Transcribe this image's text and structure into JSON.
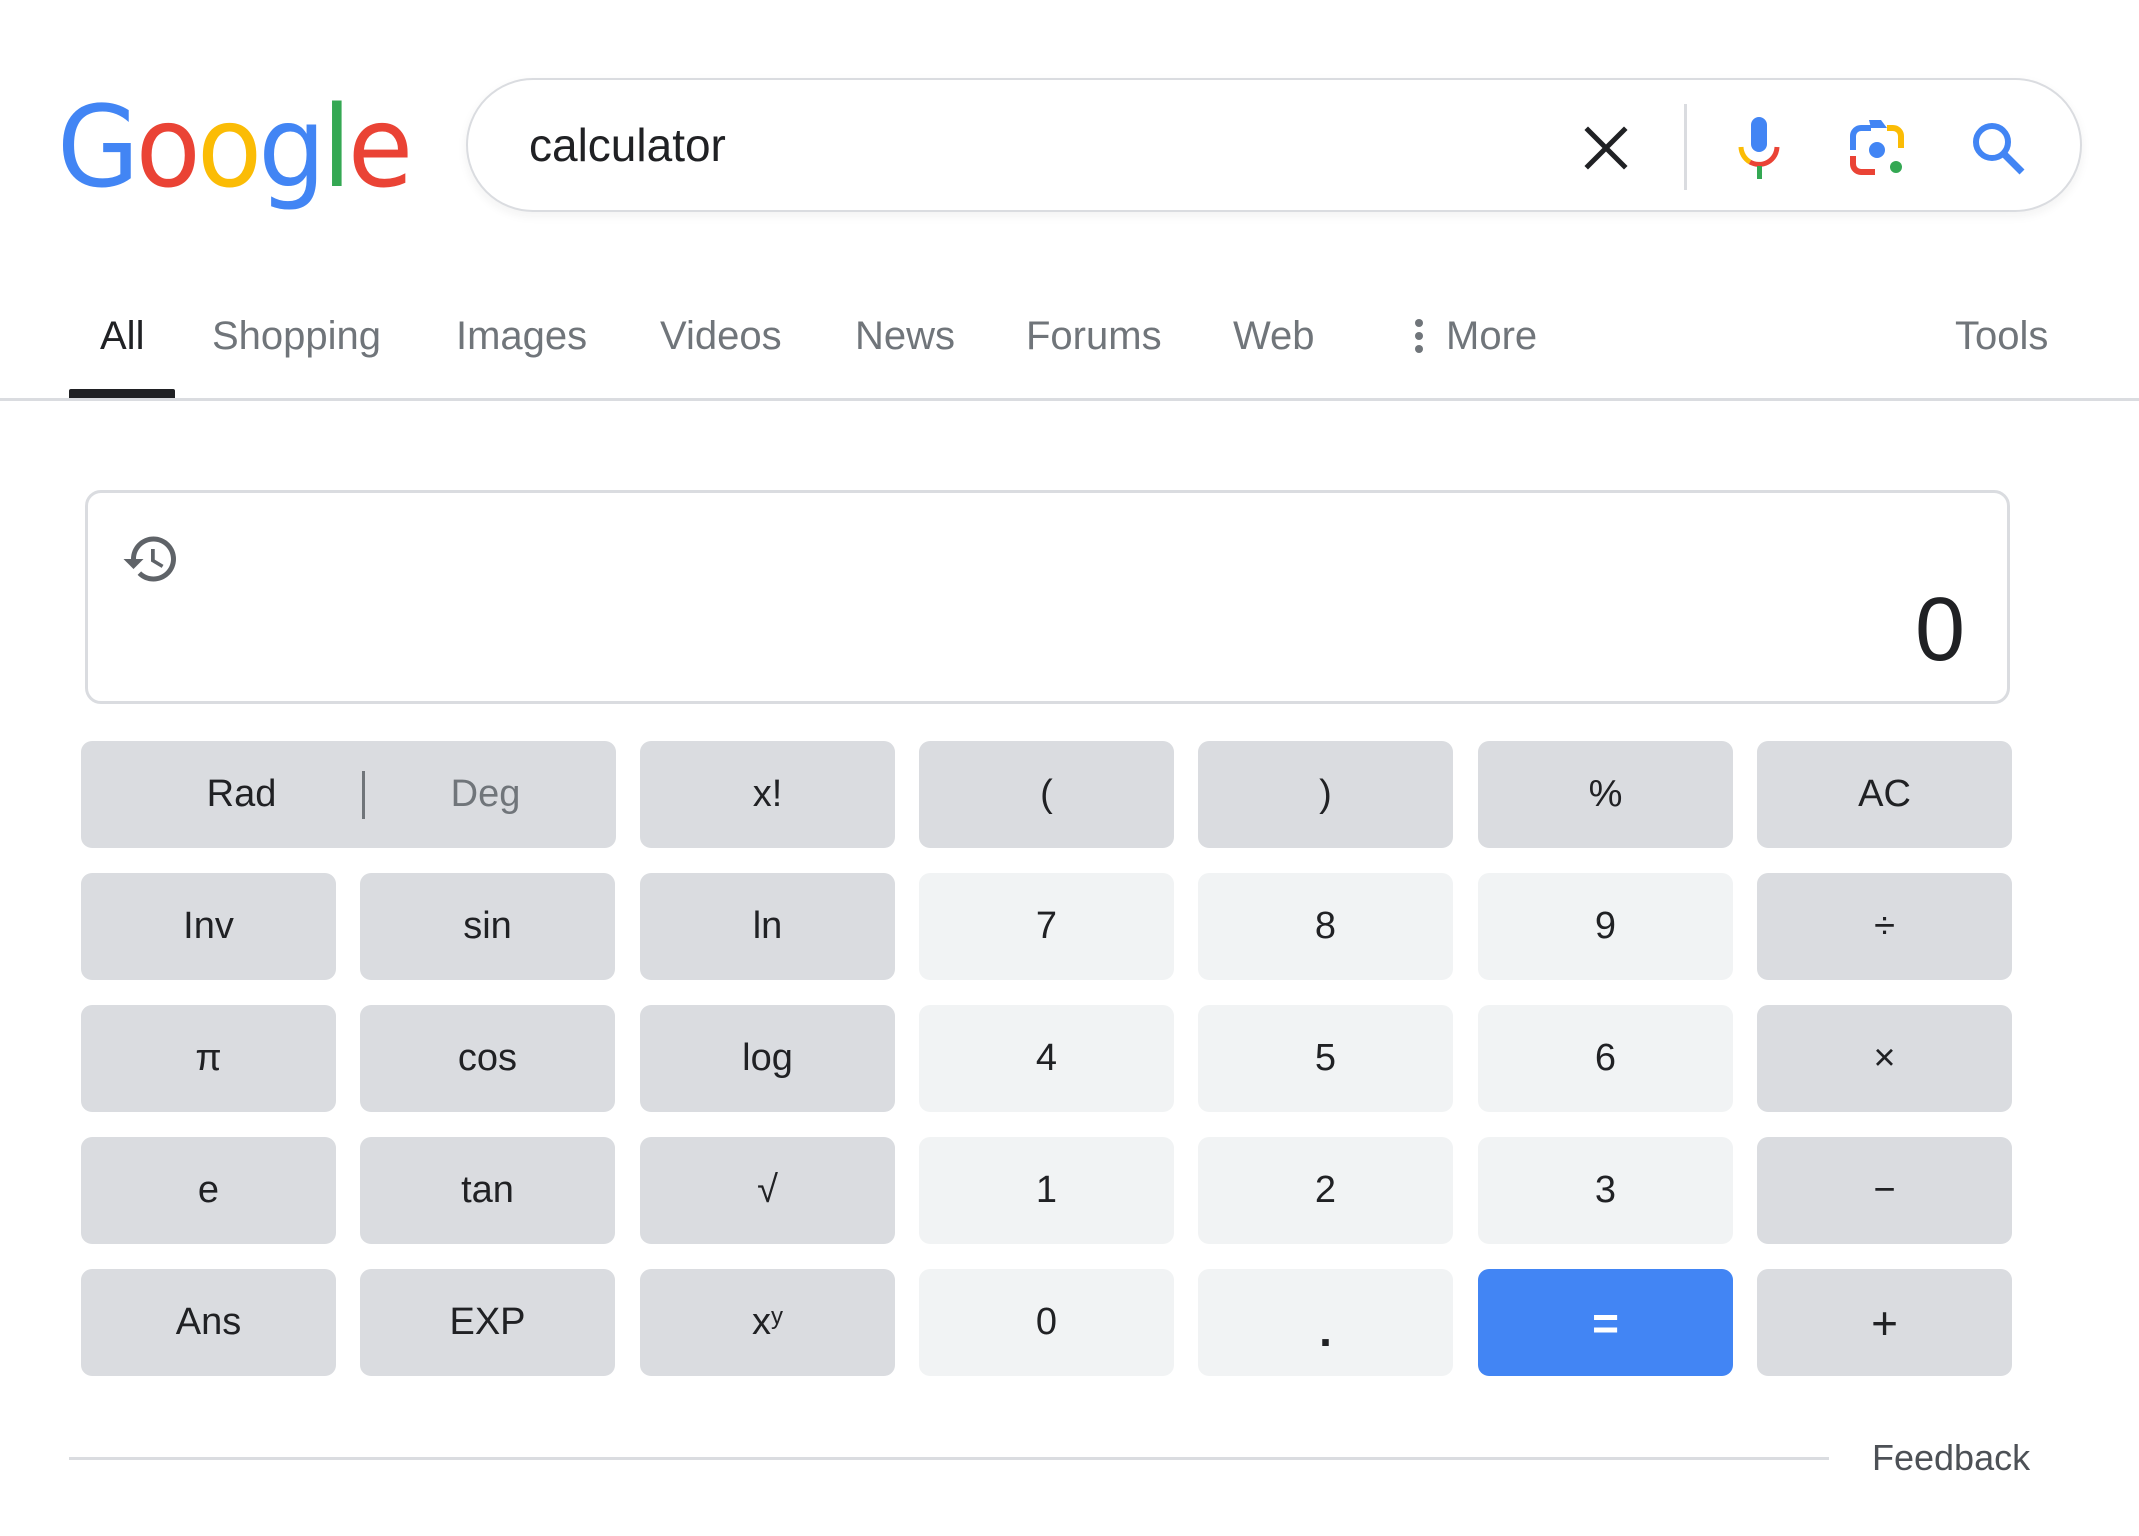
{
  "logo": {
    "letters": [
      {
        "char": "G",
        "color": "#4285f4"
      },
      {
        "char": "o",
        "color": "#ea4335"
      },
      {
        "char": "o",
        "color": "#fbbc05"
      },
      {
        "char": "g",
        "color": "#4285f4"
      },
      {
        "char": "l",
        "color": "#34a853"
      },
      {
        "char": "e",
        "color": "#ea4335"
      }
    ]
  },
  "search": {
    "query": "calculator",
    "icons": [
      "clear-icon",
      "microphone-icon",
      "google-lens-icon",
      "search-icon"
    ]
  },
  "tabs": [
    {
      "label": "All",
      "active": true
    },
    {
      "label": "Shopping"
    },
    {
      "label": "Images"
    },
    {
      "label": "Videos"
    },
    {
      "label": "News"
    },
    {
      "label": "Forums"
    },
    {
      "label": "Web"
    },
    {
      "label": "More",
      "icon": "more-vert-icon"
    }
  ],
  "tools_label": "Tools",
  "calculator": {
    "display_value": "0",
    "history_icon": "history-icon",
    "angle_mode": {
      "rad": "Rad",
      "deg": "Deg",
      "selected": "Rad"
    },
    "rows": [
      [
        "x!",
        "(",
        ")",
        "%",
        "AC"
      ],
      [
        "Inv",
        "sin",
        "ln",
        "7",
        "8",
        "9",
        "÷"
      ],
      [
        "π",
        "cos",
        "log",
        "4",
        "5",
        "6",
        "×"
      ],
      [
        "e",
        "tan",
        "√",
        "1",
        "2",
        "3",
        "−"
      ],
      [
        "Ans",
        "EXP",
        "x",
        "0",
        ".",
        "=",
        "+"
      ]
    ],
    "xy_superscript": "y"
  },
  "colors": {
    "accent_blue": "#4285f4",
    "key_function_bg": "#dadce0",
    "key_digit_bg": "#f1f3f4",
    "text_primary": "#202124",
    "text_secondary": "#70757a"
  },
  "footer": {
    "feedback_label": "Feedback"
  }
}
